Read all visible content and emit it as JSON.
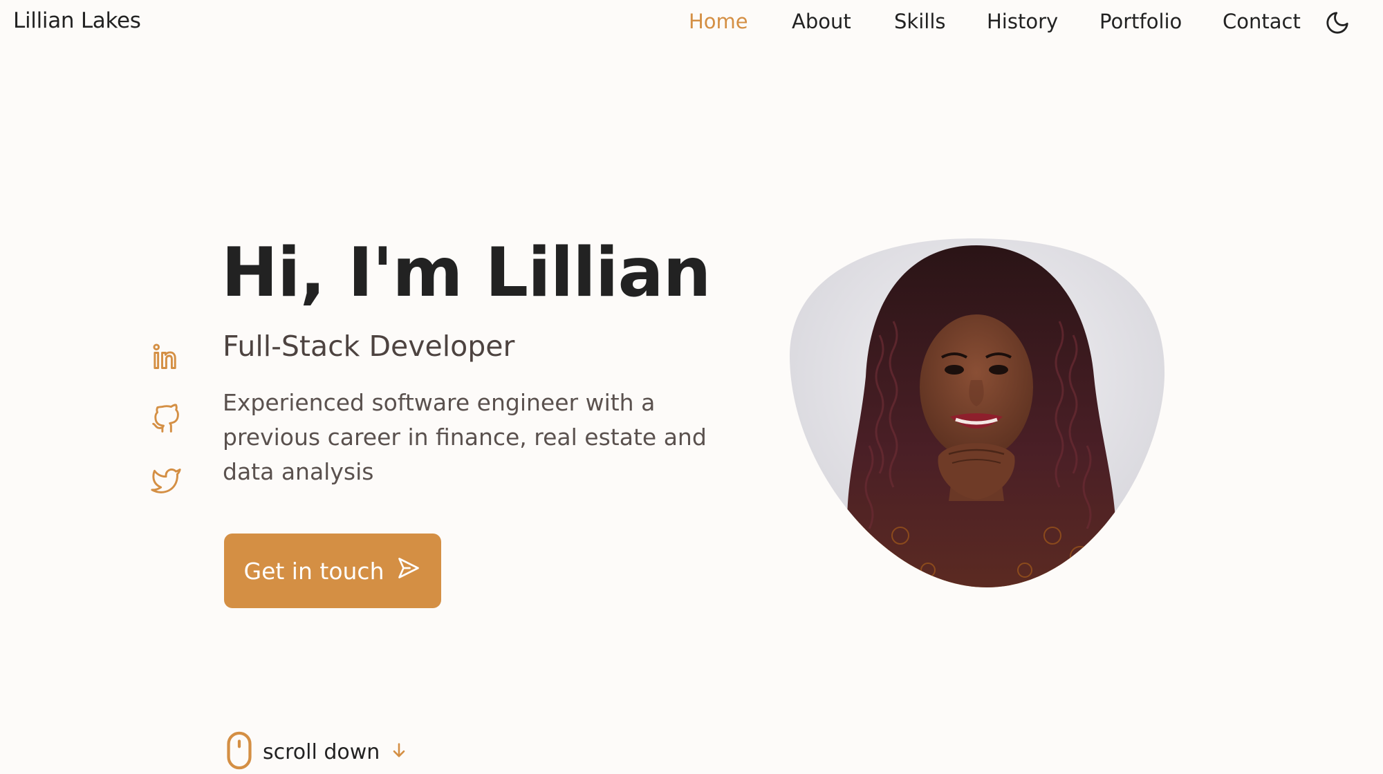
{
  "header": {
    "logo": "Lillian Lakes",
    "nav": [
      "Home",
      "About",
      "Skills",
      "History",
      "Portfolio",
      "Contact"
    ],
    "active": "Home",
    "theme_icon": "moon-icon"
  },
  "social": [
    "linkedin-icon",
    "github-icon",
    "twitter-icon"
  ],
  "hero": {
    "title": "Hi, I'm Lillian",
    "subtitle": "Full-Stack Developer",
    "description": "Experienced software engineer with a previous career in finance, real estate and data analysis",
    "cta_label": "Get in touch",
    "cta_icon": "send-icon"
  },
  "scroll": {
    "label": "scroll down",
    "icons": [
      "mouse-icon",
      "arrow-down-icon"
    ]
  },
  "colors": {
    "accent": "#d48f44",
    "background": "#fdfbf9",
    "text": "#222222"
  }
}
